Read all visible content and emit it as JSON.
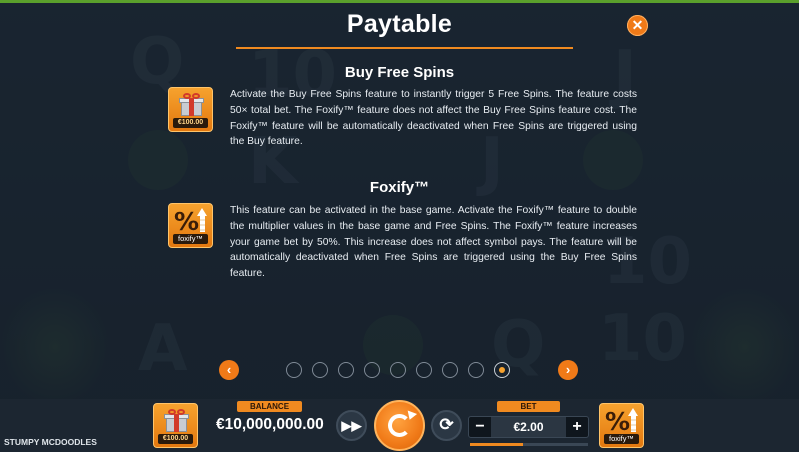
{
  "paytable": {
    "title": "Paytable",
    "close_icon": "close-icon",
    "sections": [
      {
        "title": "Buy Free Spins",
        "icon": "gift-icon",
        "icon_price": "€100.00",
        "text": "Activate the Buy Free Spins feature to instantly trigger 5 Free Spins. The feature costs 50× total bet. The Foxify™ feature does not affect the Buy Free Spins feature cost. The Foxify™ feature will be automatically deactivated when Free Spins are triggered using the Buy feature."
      },
      {
        "title": "Foxify™",
        "icon": "foxify-icon",
        "icon_glyph": "%",
        "icon_caption": "foxify™",
        "text": "This feature can be activated in the base game. Activate the Foxify™ feature to double the multiplier values in the base game and Free Spins. The Foxify™ feature increases your game bet by 50%. This increase does not affect symbol pays. The feature will be automatically deactivated when Free Spins are triggered using the Buy Free Spins feature."
      }
    ],
    "nav": {
      "prev_glyph": "‹",
      "next_glyph": "›",
      "page_count": 9,
      "current_page": 9
    }
  },
  "background_symbols": [
    "Q",
    "10",
    "J",
    "K",
    "J",
    "10",
    "A",
    "Q",
    "10"
  ],
  "bottom_bar": {
    "game_name": "STUMPY MCDOODLES",
    "buy_button_price": "€100.00",
    "balance_label": "BALANCE",
    "balance_value": "€10,000,000.00",
    "turbo_icon": "fast-forward-icon",
    "spin_icon": "spin-icon",
    "autoplay_icon": "autoplay-icon",
    "bet_label": "BET",
    "bet_value": "€2.00",
    "bet_minus": "−",
    "bet_plus": "+",
    "bet_level": 0.45,
    "foxify_caption": "foxify™",
    "foxify_glyph": "%"
  },
  "colors": {
    "accent": "#f07a18",
    "accent_light": "#f6a22e",
    "background": "#1f2d3b",
    "top_strip": "#5aa02c"
  }
}
